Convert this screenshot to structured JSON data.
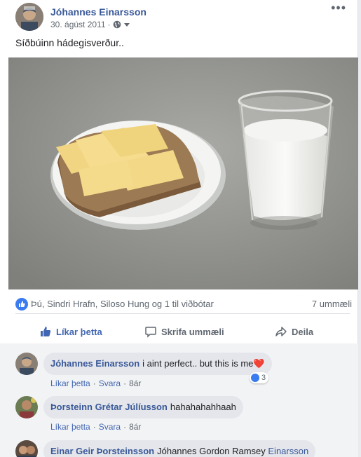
{
  "post": {
    "author": "Jóhannes Einarsson",
    "date": "30. ágúst 2011",
    "separator": "·",
    "more_label": "•••",
    "text": "Síðbúinn hádegisverður.."
  },
  "reactions": {
    "names": "Þú, Sindri Hrafn, Siloso Hung og 1 til viðbótar",
    "comments_count": "7 ummæli"
  },
  "actions": {
    "like": "Líkar þetta",
    "comment": "Skrifa ummæli",
    "share": "Deila"
  },
  "comments": [
    {
      "author": "Jóhannes Einarsson",
      "text": "i aint perfect.. but this is me",
      "emoji": "❤️",
      "like": "Líkar þetta",
      "reply": "Svara",
      "time": "8ár",
      "reactions": "3"
    },
    {
      "author": "Þorsteinn Grétar Júlíusson",
      "text": "hahahahahhaah",
      "like": "Líkar þetta",
      "reply": "Svara",
      "time": "8ár"
    },
    {
      "author": "Einar Geir Þorsteinsson",
      "text": "Jóhannes Gordon Ramsey",
      "mention": "Einarsson"
    }
  ],
  "colors": {
    "link_blue": "#385898",
    "like_blue": "#4267b2",
    "bubble_gray": "#e4e6eb",
    "heart_red": "#e0245e"
  },
  "icons": [
    "globe-icon",
    "caret-down-icon",
    "like-icon",
    "comment-icon",
    "share-icon",
    "more-icon"
  ]
}
